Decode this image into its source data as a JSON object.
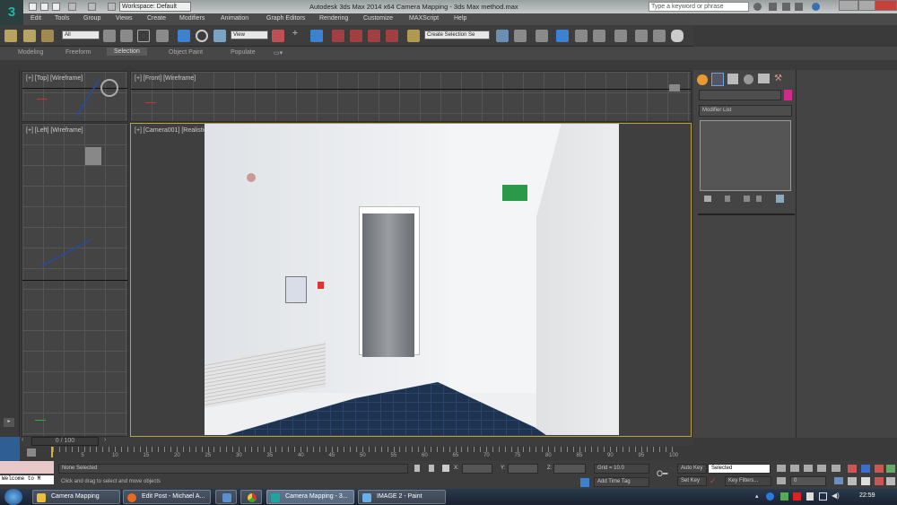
{
  "titlebar": {
    "workspace": "Workspace: Default",
    "title": "Autodesk 3ds Max 2014 x64     Camera Mapping - 3ds Max method.max",
    "search_placeholder": "Type a keyword or phrase"
  },
  "menu": [
    "Edit",
    "Tools",
    "Group",
    "Views",
    "Create",
    "Modifiers",
    "Animation",
    "Graph Editors",
    "Rendering",
    "Customize",
    "MAXScript",
    "Help"
  ],
  "toolbar": {
    "selection_filter": "All",
    "ref_coord": "View",
    "named_selection": "Create Selection Se"
  },
  "ribbon": {
    "tabs": [
      "Modeling",
      "Freeform",
      "Selection",
      "Object Paint",
      "Populate"
    ],
    "active": "Selection"
  },
  "viewports": {
    "top": "[+] [Top] [Wireframe]",
    "front": "[+] [Front] [Wireframe]",
    "left": "[+] [Left] [Wireframe]",
    "camera": "[+] [Camera001] [Realistic]"
  },
  "command_panel": {
    "modifier_list": "Modifier List",
    "object_color": "#d02a8a"
  },
  "timeline": {
    "frame": "0 / 100",
    "ticks": [
      "5",
      "10",
      "15",
      "20",
      "25",
      "30",
      "35",
      "40",
      "45",
      "50",
      "55",
      "60",
      "65",
      "70",
      "75",
      "80",
      "85",
      "90",
      "95",
      "100"
    ]
  },
  "status": {
    "welcome": "Welcome to M",
    "selection": "None Selected",
    "prompt": "Click and drag to select and move objects",
    "x_label": "X:",
    "y_label": "Y:",
    "z_label": "Z:",
    "grid": "Grid = 10.0",
    "add_time_tag": "Add Time Tag",
    "auto_key": "Auto Key",
    "set_key": "Set Key",
    "key_mode": "Selected",
    "key_filters": "Key Filters...",
    "frame_field": "0"
  },
  "taskbar": {
    "items": [
      "Camera Mapping",
      "Edit Post - Michael A...",
      "Camera Mapping - 3...",
      "IMAGE 2 - Paint"
    ],
    "clock": "22:59"
  }
}
